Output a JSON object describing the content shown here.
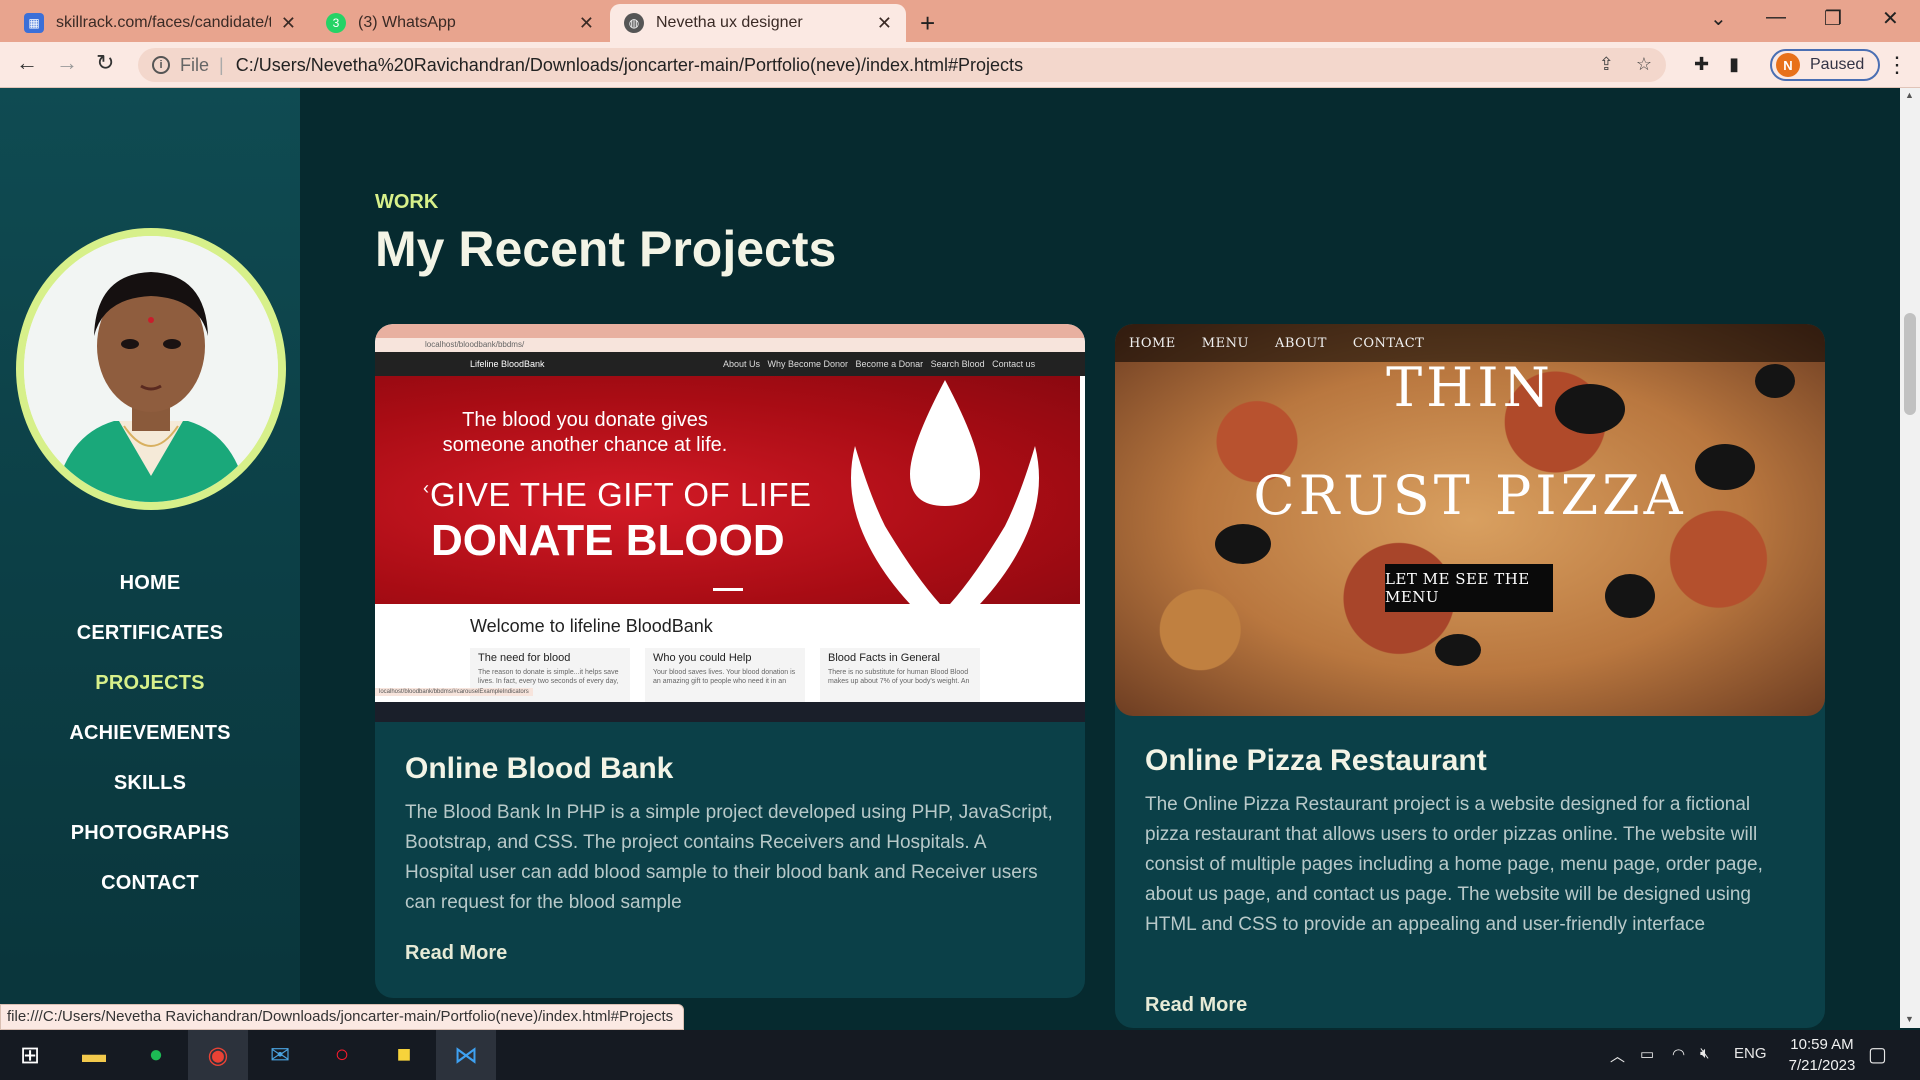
{
  "browser": {
    "tabs": [
      {
        "title": "skillrack.com/faces/candidate/tra",
        "icon": "skillrack-icon"
      },
      {
        "title": "(3) WhatsApp",
        "icon": "whatsapp-icon"
      },
      {
        "title": "Nevetha ux designer",
        "icon": "globe-icon",
        "active": true
      }
    ],
    "address": {
      "scheme_label": "File",
      "url": "C:/Users/Nevetha%20Ravichandran/Downloads/joncarter-main/Portfolio(neve)/index.html#Projects"
    },
    "profile": {
      "initial": "N",
      "label": "Paused"
    },
    "status_url": "file:///C:/Users/Nevetha Ravichandran/Downloads/joncarter-main/Portfolio(neve)/index.html#Projects"
  },
  "sidebar": {
    "nav": [
      {
        "label": "HOME"
      },
      {
        "label": "CERTIFICATES"
      },
      {
        "label": "PROJECTS",
        "active": true
      },
      {
        "label": "ACHIEVEMENTS"
      },
      {
        "label": "SKILLS"
      },
      {
        "label": "PHOTOGRAPHS"
      },
      {
        "label": "CONTACT"
      }
    ]
  },
  "main": {
    "eyebrow": "WORK",
    "heading": "My Recent Projects",
    "projects": [
      {
        "title": "Online Blood Bank",
        "description": "The Blood Bank In PHP is a simple project developed using PHP, JavaScript, Bootstrap, and CSS. The project contains Receivers and Hospitals. A Hospital user can add blood sample to their blood bank and Receiver users can request for the blood sample",
        "read_more": "Read More",
        "thumb": {
          "addr": "localhost/bloodbank/bbdms/",
          "brand": "Lifeline BloodBank",
          "nav_links": "About Us   Why Become Donor   Become a Donar   Search Blood   Contact us",
          "tagline": "The blood you donate gives someone another chance at life.",
          "headline1": "GIVE THE GIFT OF LIFE",
          "headline2": "DONATE BLOOD",
          "welcome": "Welcome to lifeline BloodBank",
          "col1_title": "The need for blood",
          "col1_text": "The reason to donate is simple...it helps save lives. In fact, every two seconds of every day,",
          "col2_title": "Who you could Help",
          "col2_text": "Your blood saves lives. Your blood donation is an amazing gift to people who need it in an",
          "col3_title": "Blood Facts in General",
          "col3_text": "There is no substitute for human Blood Blood makes up about 7% of your body's weight. An",
          "status": "localhost/bloodbank/bbdms/#carouselExampleIndicators"
        }
      },
      {
        "title": "Online Pizza Restaurant",
        "description": "The Online Pizza Restaurant project is a website designed for a fictional pizza restaurant that allows users to order pizzas online. The website will consist of multiple pages including a home page, menu page, order page, about us page, and contact us page. The website will be designed using HTML and CSS to provide an appealing and user-friendly interface",
        "read_more": "Read More",
        "thumb": {
          "nav": [
            "HOME",
            "MENU",
            "ABOUT",
            "CONTACT"
          ],
          "title_line1": "THIN",
          "title_line2": "CRUST PIZZA",
          "button": "LET ME SEE THE MENU"
        }
      }
    ]
  },
  "taskbar": {
    "apps": [
      "windows-start-icon",
      "file-explorer-icon",
      "spotify-icon",
      "chrome-icon",
      "outlook-icon",
      "opera-icon",
      "sticky-notes-icon",
      "vscode-icon"
    ],
    "language": "ENG",
    "time": "10:59 AM",
    "date": "7/21/2023"
  },
  "colors": {
    "accent": "#d7f08a",
    "page_bg": "#062a2f",
    "card_bg": "#0b4048",
    "sidebar_bg": "#0f4b52",
    "tabbar": "#e8a48e"
  }
}
